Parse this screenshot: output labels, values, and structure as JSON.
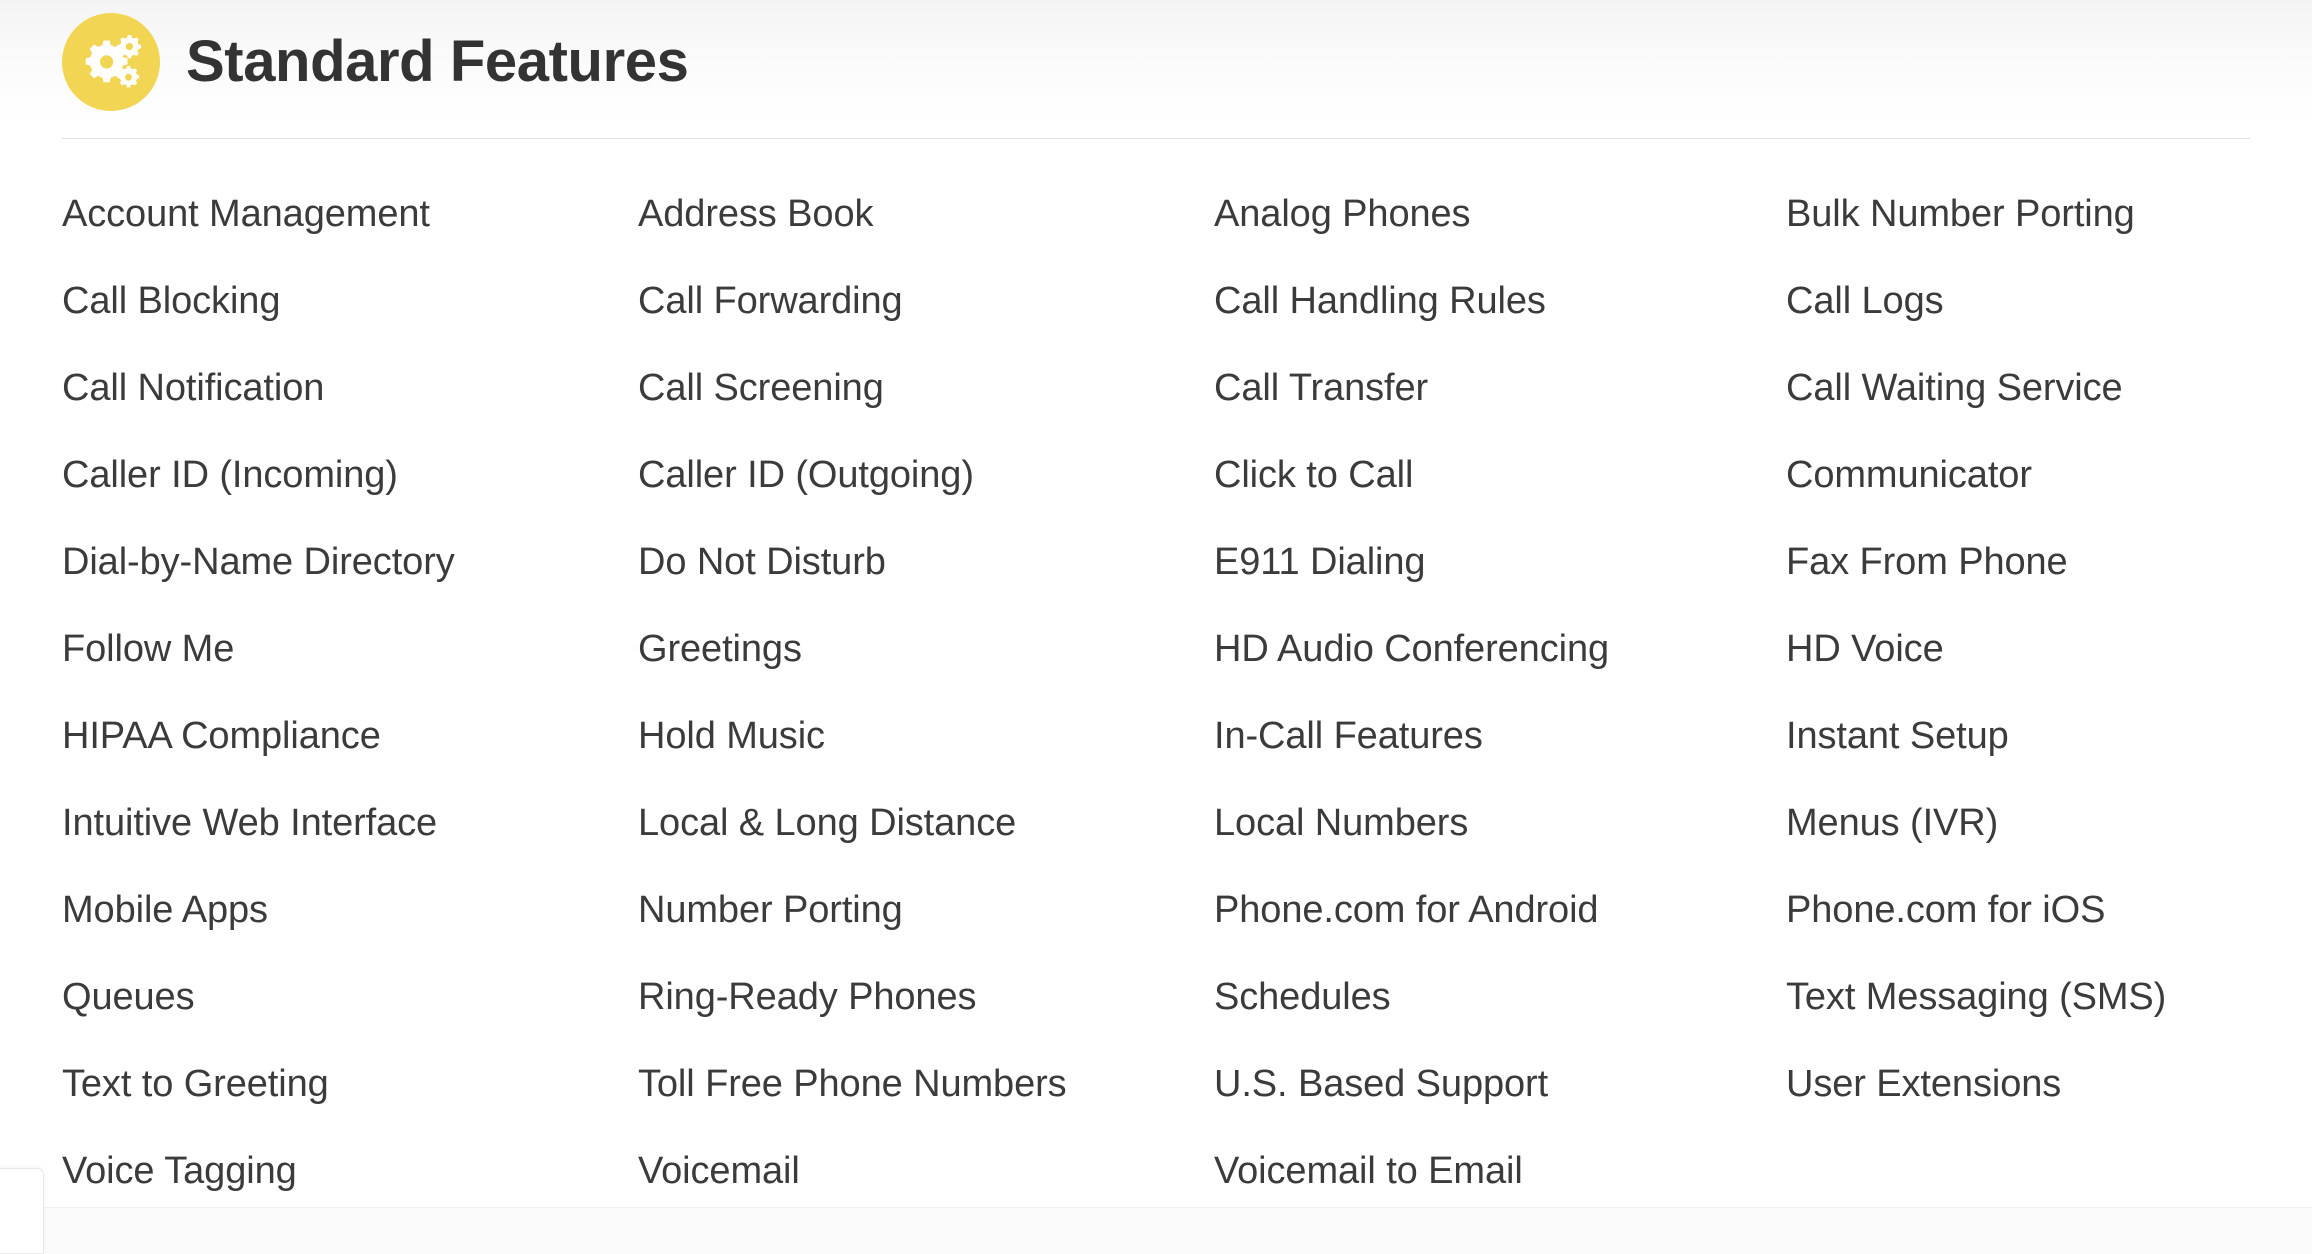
{
  "header": {
    "icon": "gears-icon",
    "icon_color": "#f2d552",
    "title": "Standard Features"
  },
  "features": {
    "columns": [
      [
        "Account Management",
        "Call Blocking",
        "Call Notification",
        "Caller ID (Incoming)",
        "Dial-by-Name Directory",
        "Follow Me",
        "HIPAA Compliance",
        "Intuitive Web Interface",
        "Mobile Apps",
        "Queues",
        "Text to Greeting",
        "Voice Tagging"
      ],
      [
        "Address Book",
        "Call Forwarding",
        "Call Screening",
        "Caller ID (Outgoing)",
        "Do Not Disturb",
        "Greetings",
        "Hold Music",
        "Local & Long Distance",
        "Number Porting",
        "Ring-Ready Phones",
        "Toll Free Phone Numbers",
        "Voicemail"
      ],
      [
        "Analog Phones",
        "Call Handling Rules",
        "Call Transfer",
        "Click to Call",
        "E911 Dialing",
        "HD Audio Conferencing",
        "In-Call Features",
        "Local Numbers",
        "Phone.com for Android",
        "Schedules",
        "U.S. Based Support",
        "Voicemail to Email"
      ],
      [
        "Bulk Number Porting",
        "Call Logs",
        "Call Waiting Service",
        "Communicator",
        "Fax From Phone",
        "HD Voice",
        "Instant Setup",
        "Menus (IVR)",
        "Phone.com for iOS",
        "Text Messaging (SMS)",
        "User Extensions"
      ]
    ]
  },
  "colors": {
    "accent": "#f2d552",
    "text": "#3b3b3b",
    "title": "#333333",
    "divider": "#e2e2e2"
  }
}
